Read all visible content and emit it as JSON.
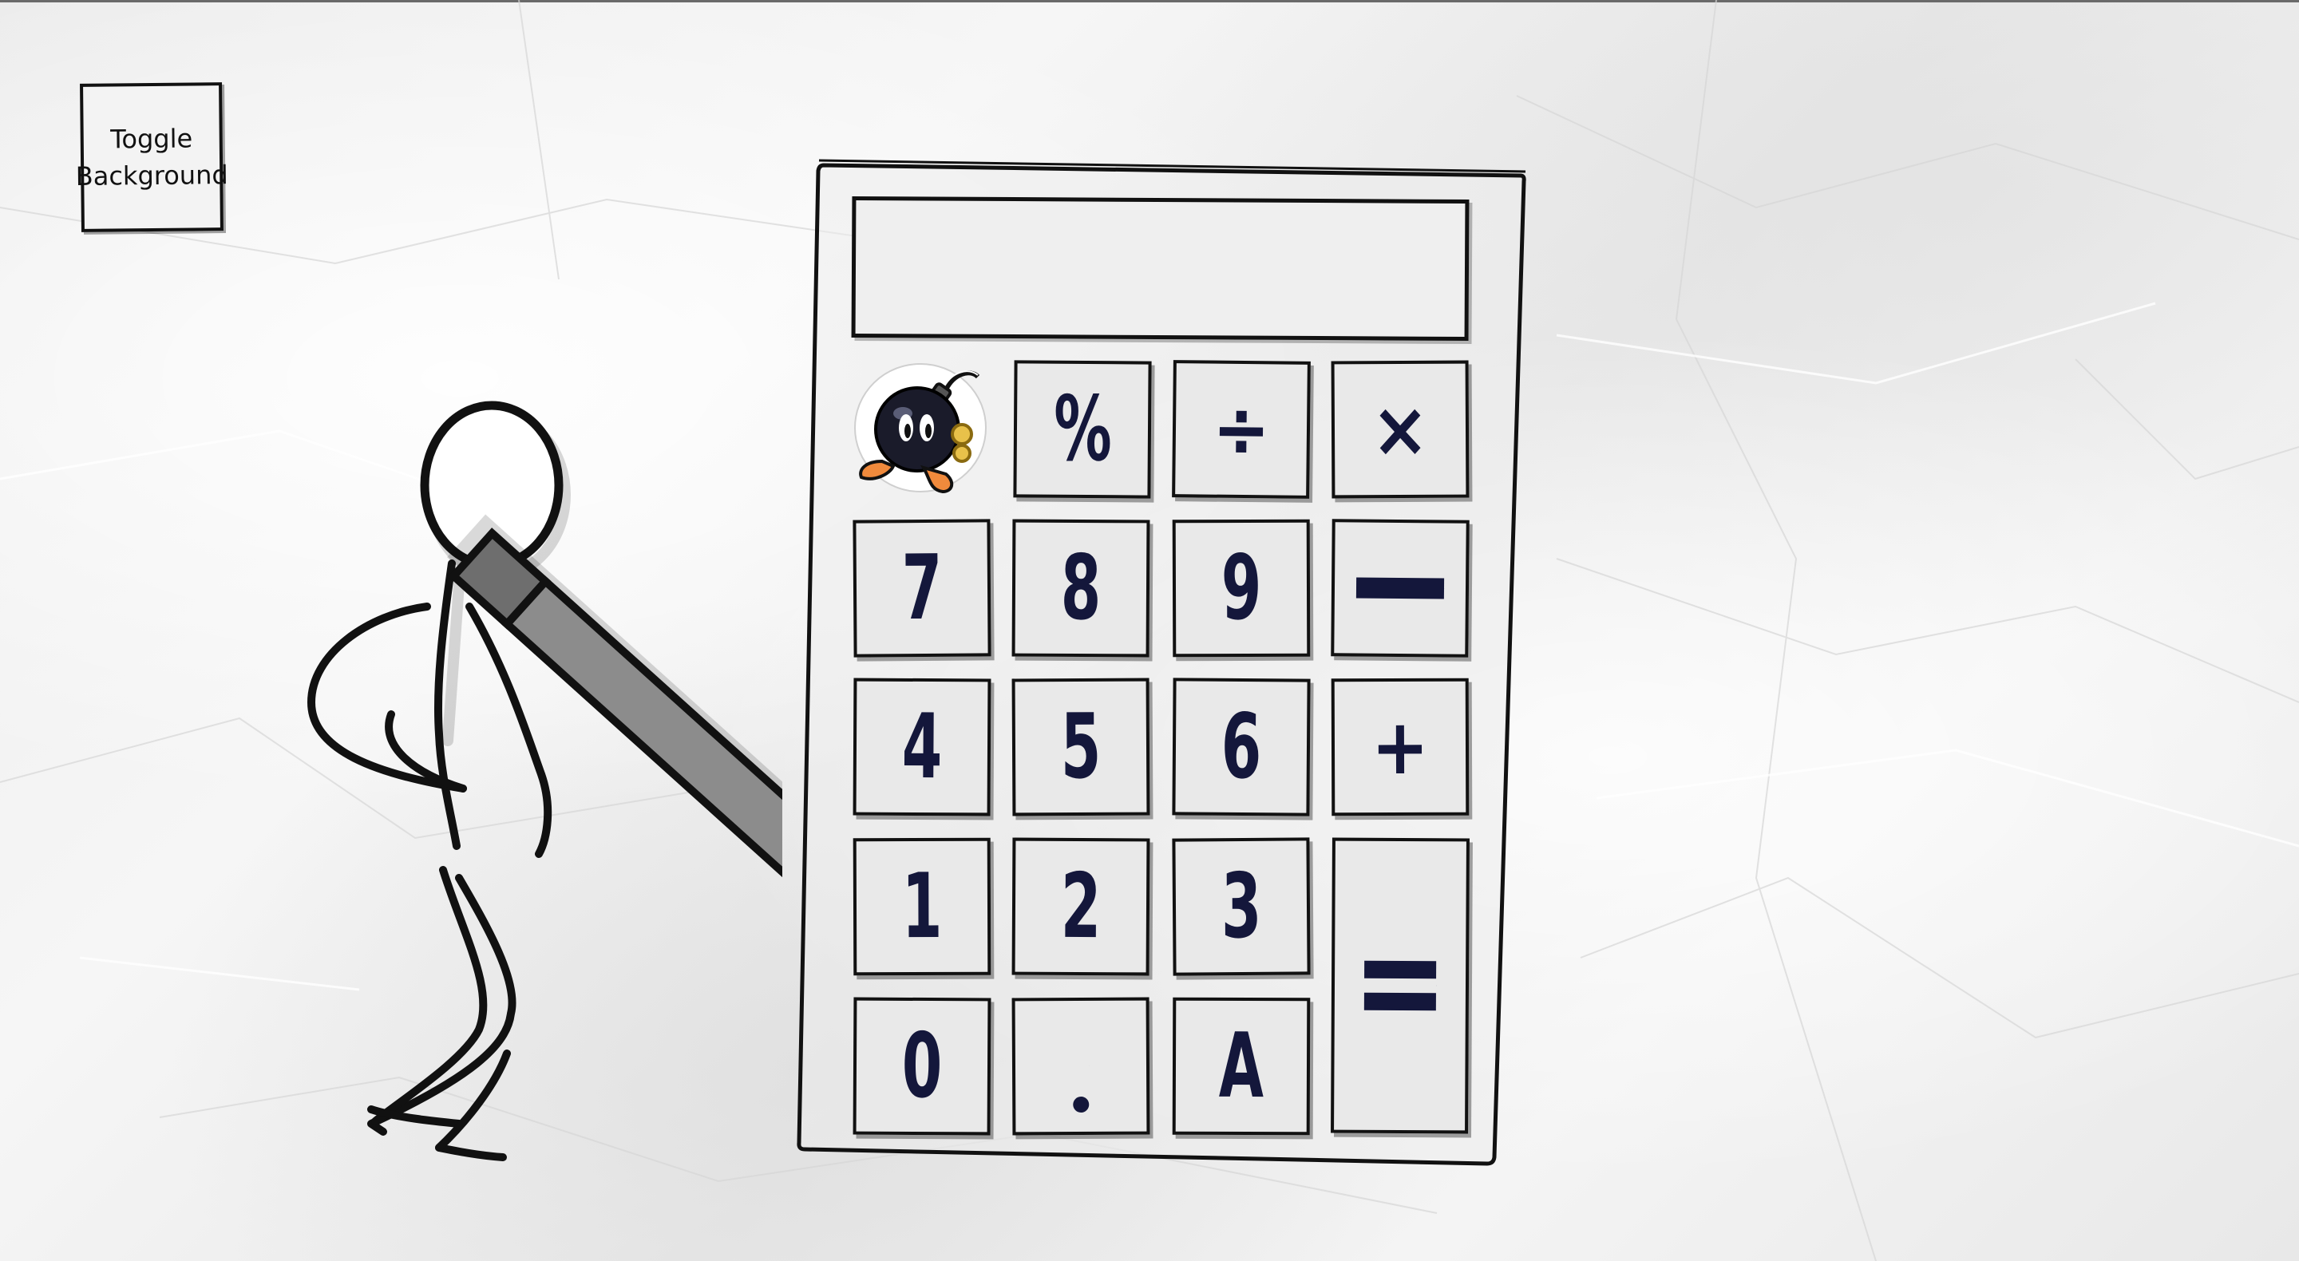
{
  "toggle_button": {
    "line1": "Toggle",
    "line2": "Background"
  },
  "calculator": {
    "display_value": "",
    "keys": {
      "percent": "%",
      "divide": "÷",
      "multiply": "×",
      "seven": "7",
      "eight": "8",
      "nine": "9",
      "minus": "−",
      "four": "4",
      "five": "5",
      "six": "6",
      "plus": "+",
      "one": "1",
      "two": "2",
      "three": "3",
      "equals": "=",
      "zero": "0",
      "decimal": ".",
      "clear": "A"
    }
  },
  "icons": {
    "bomb": "bob-omb-icon",
    "stickman": "stick-figure-with-pencil"
  },
  "colors": {
    "key_text": "#14173b",
    "key_face": "#e9e9e9",
    "outline": "#111111",
    "pencil": "#8c8c8c"
  }
}
